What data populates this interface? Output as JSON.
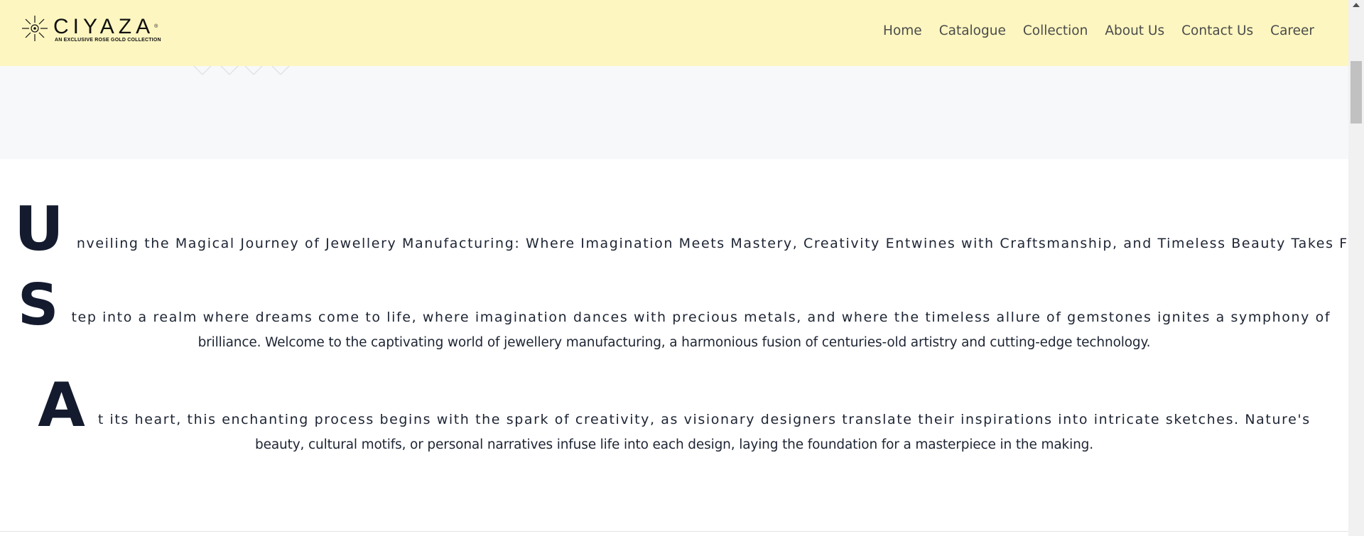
{
  "brand": {
    "name": "CIYAZA",
    "registered_mark": "®",
    "tagline": "AN EXCLUSIVE ROSE GOLD COLLECTION"
  },
  "nav": {
    "items": [
      {
        "label": "Home"
      },
      {
        "label": "Catalogue"
      },
      {
        "label": "Collection"
      },
      {
        "label": "About Us"
      },
      {
        "label": "Contact Us"
      },
      {
        "label": "Career"
      }
    ]
  },
  "intro": {
    "p1": {
      "initial": "U",
      "first": "nveiling the Magical Journey of Jewellery Manufacturing: Where Imagination Meets Mastery, Creativity Entwines with Craftsmanship, and Timeless Beauty Takes Form."
    },
    "p2": {
      "initial": "S",
      "first": "tep into a realm where dreams come to life, where imagination dances with precious metals, and where the timeless allure of gemstones ignites a symphony of",
      "rest": "brilliance. Welcome to the captivating world of jewellery manufacturing, a harmonious fusion of centuries-old artistry and cutting-edge technology."
    },
    "p3": {
      "initial": "A",
      "first": "t its heart, this enchanting process begins with the spark of creativity, as visionary designers translate their inspirations into intricate sketches. Nature's",
      "rest": "beauty, cultural motifs, or personal narratives infuse life into each design, laying the foundation for a masterpiece in the making."
    }
  },
  "colors": {
    "header_bg": "#fdf6c0",
    "hero_bg": "#f7f8fa",
    "drop_cap": "#141b2e"
  },
  "icons": {
    "logo": "sun-star-logo-icon",
    "scroll_up": "scroll-up-arrow-icon"
  }
}
